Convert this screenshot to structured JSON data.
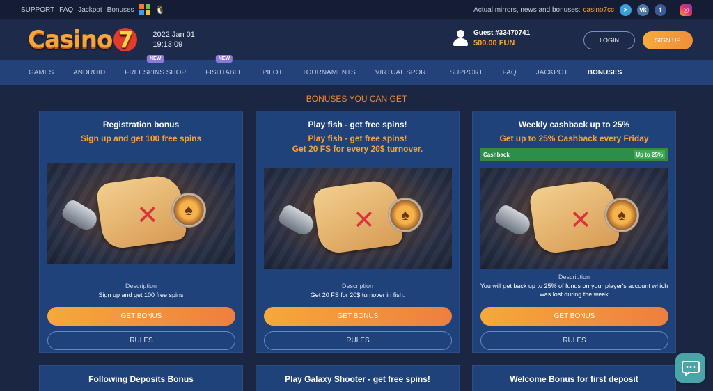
{
  "topbar": {
    "links": [
      "SUPPORT",
      "FAQ",
      "Jackpot",
      "Bonuses"
    ],
    "mirror_text": "Actual mirrors, news and bonuses:",
    "mirror_link": "casino7cc",
    "socials": [
      "telegram-icon",
      "vk-icon",
      "facebook-icon",
      "instagram-icon"
    ]
  },
  "header": {
    "logo": "Casino",
    "logo_seven": "7",
    "date": "2022 Jan 01",
    "time": "19:13:09",
    "guest_name": "Guest #33470741",
    "balance": "500.00 FUN",
    "login_label": "LOGIN",
    "signup_label": "SIGN UP"
  },
  "nav": {
    "items": [
      {
        "label": "GAMES"
      },
      {
        "label": "ANDROID"
      },
      {
        "label": "FREESPINS SHOP",
        "badge": "NEW"
      },
      {
        "label": "FISHTABLE",
        "badge": "NEW"
      },
      {
        "label": "PILOT"
      },
      {
        "label": "TOURNAMENTS"
      },
      {
        "label": "VIRTUAL SPORT"
      },
      {
        "label": "SUPPORT"
      },
      {
        "label": "FAQ"
      },
      {
        "label": "JACKPOT"
      },
      {
        "label": "BONUSES",
        "active": true
      }
    ]
  },
  "section_title": "BONUSES YOU CAN GET",
  "cards": [
    {
      "title": "Registration bonus",
      "subtitle": "Sign up and get 100 free spins",
      "description_label": "Description",
      "description": "Sign up and get 100 free spins",
      "get_label": "GET BONUS",
      "rules_label": "RULES"
    },
    {
      "title": "Play fish - get free spins!",
      "subtitle": "Play fish - get free spins!\nGet 20 FS for every 20$ turnover.",
      "description_label": "Description",
      "description": "Get 20 FS for 20$ turnover in fish.",
      "get_label": "GET BONUS",
      "rules_label": "RULES"
    },
    {
      "title": "Weekly cashback up to 25%",
      "subtitle": "Get up to 25% Cashback every Friday",
      "bar_left": "Cashback",
      "bar_right": "Up to 25%",
      "description_label": "Description",
      "description": "You will get back up to 25% of funds on your player's account which was lost during the week",
      "get_label": "GET BONUS",
      "rules_label": "RULES"
    },
    {
      "title": "Following Deposits Bonus"
    },
    {
      "title": "Play Galaxy Shooter - get free spins!"
    },
    {
      "title": "Welcome Bonus for first deposit"
    }
  ]
}
